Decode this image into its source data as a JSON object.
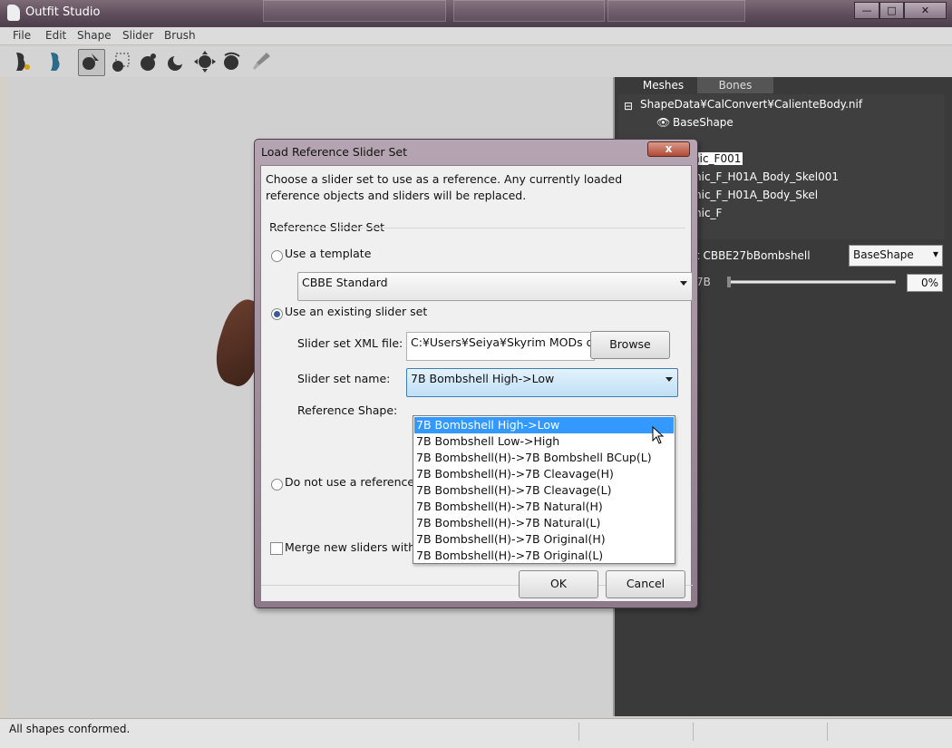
{
  "window": {
    "title": "Outfit Studio",
    "min": "▭",
    "max": "□",
    "close": "✕"
  },
  "menu": [
    "File",
    "Edit",
    "Shape",
    "Slider",
    "Brush"
  ],
  "toolbar": {
    "tools": [
      "outfit-icon",
      "reference-icon",
      "select-brush-icon",
      "mask-brush-icon",
      "inflate-brush-icon",
      "deflate-brush-icon",
      "move-brush-icon",
      "smooth-brush-icon",
      "paint-brush-icon"
    ]
  },
  "right_panel": {
    "tabs": [
      "Meshes",
      "Bones"
    ],
    "tree": {
      "root": "ShapeData¥CalConvert¥CalienteBody.nif",
      "base_shape": "BaseShape",
      "items": [
        "nic_F001",
        "nic_F_H01A_Body_Skel001",
        "nic_F_H01A_Body_Skel",
        "nic_F"
      ]
    },
    "conversion_label": "rt CBBE27bBombshell",
    "shape_select": "BaseShape",
    "slider_label": "7B",
    "slider_value": "0%"
  },
  "status": {
    "text": "All shapes conformed."
  },
  "dialog": {
    "title": "Load Reference Slider Set",
    "close_label": "x",
    "intro_line1": "Choose a slider set to use as a reference.  Any currently loaded",
    "intro_line2": "reference objects and sliders will be replaced.",
    "group_label": "Reference Slider Set",
    "option_template": "Use a template",
    "template_value": "CBBE Standard",
    "option_existing": "Use an existing slider set",
    "xml_label": "Slider set XML file:",
    "xml_value": "C:¥Users¥Seiya¥Skyrim MODs d",
    "browse_label": "Browse",
    "name_label": "Slider set name:",
    "name_value": "7B Bombshell High->Low",
    "ref_shape_label": "Reference Shape:",
    "option_none": "Do not use a reference",
    "merge_label": "Merge new sliders with existing sliders",
    "ok_label": "OK",
    "cancel_label": "Cancel",
    "dropdown_items": [
      "7B Bombshell High->Low",
      "7B Bombshell Low->High",
      "7B Bombshell(H)->7B Bombshell BCup(L)",
      "7B Bombshell(H)->7B Cleavage(H)",
      "7B Bombshell(H)->7B Cleavage(L)",
      "7B Bombshell(H)->7B Natural(H)",
      "7B Bombshell(H)->7B Natural(L)",
      "7B Bombshell(H)->7B Original(H)",
      "7B Bombshell(H)->7B Original(L)"
    ],
    "dropdown_selected": 0,
    "radio_selected": "existing",
    "merge_checked": false
  },
  "colors": {
    "selection": "#3399ff",
    "panel_dark": "#3a3a3a",
    "title_bar": "#5e4c5a"
  }
}
